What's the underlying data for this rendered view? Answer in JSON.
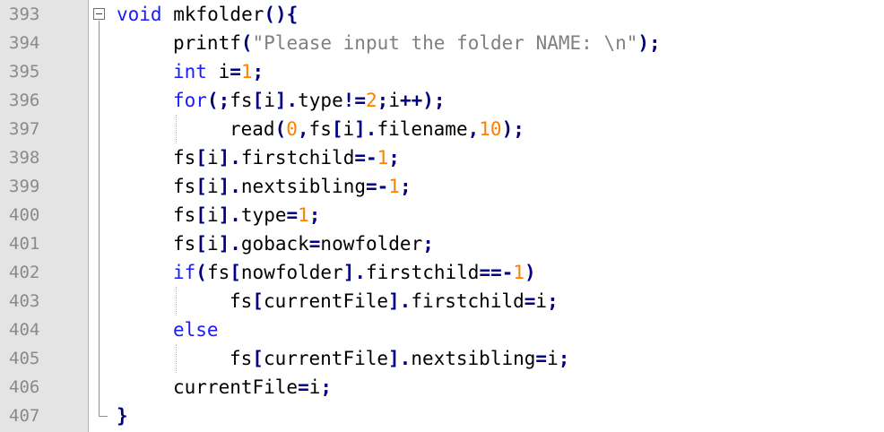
{
  "editor": {
    "lines": [
      {
        "number": "393",
        "tokens": [
          {
            "t": "void",
            "c": "kw"
          },
          {
            "t": " mkfolder",
            "c": "id"
          },
          {
            "t": "(){",
            "c": "op"
          }
        ],
        "indent": 0
      },
      {
        "number": "394",
        "tokens": [
          {
            "t": "printf",
            "c": "id"
          },
          {
            "t": "(",
            "c": "op"
          },
          {
            "t": "\"Please input the folder NAME: \\n\"",
            "c": "str"
          },
          {
            "t": ");",
            "c": "op"
          }
        ],
        "indent": 1
      },
      {
        "number": "395",
        "tokens": [
          {
            "t": "int",
            "c": "kw"
          },
          {
            "t": " i",
            "c": "id"
          },
          {
            "t": "=",
            "c": "op"
          },
          {
            "t": "1",
            "c": "num"
          },
          {
            "t": ";",
            "c": "op"
          }
        ],
        "indent": 1
      },
      {
        "number": "396",
        "tokens": [
          {
            "t": "for",
            "c": "kw"
          },
          {
            "t": "(;",
            "c": "op"
          },
          {
            "t": "fs",
            "c": "id"
          },
          {
            "t": "[",
            "c": "op"
          },
          {
            "t": "i",
            "c": "id"
          },
          {
            "t": "].",
            "c": "op"
          },
          {
            "t": "type",
            "c": "id"
          },
          {
            "t": "!=",
            "c": "op"
          },
          {
            "t": "2",
            "c": "num"
          },
          {
            "t": ";",
            "c": "op"
          },
          {
            "t": "i",
            "c": "id"
          },
          {
            "t": "++);",
            "c": "op"
          }
        ],
        "indent": 1
      },
      {
        "number": "397",
        "tokens": [
          {
            "t": "read",
            "c": "id"
          },
          {
            "t": "(",
            "c": "op"
          },
          {
            "t": "0",
            "c": "num"
          },
          {
            "t": ",",
            "c": "op"
          },
          {
            "t": "fs",
            "c": "id"
          },
          {
            "t": "[",
            "c": "op"
          },
          {
            "t": "i",
            "c": "id"
          },
          {
            "t": "].",
            "c": "op"
          },
          {
            "t": "filename",
            "c": "id"
          },
          {
            "t": ",",
            "c": "op"
          },
          {
            "t": "10",
            "c": "num"
          },
          {
            "t": ");",
            "c": "op"
          }
        ],
        "indent": 2
      },
      {
        "number": "398",
        "tokens": [
          {
            "t": "fs",
            "c": "id"
          },
          {
            "t": "[",
            "c": "op"
          },
          {
            "t": "i",
            "c": "id"
          },
          {
            "t": "].",
            "c": "op"
          },
          {
            "t": "firstchild",
            "c": "id"
          },
          {
            "t": "=-",
            "c": "op"
          },
          {
            "t": "1",
            "c": "num"
          },
          {
            "t": ";",
            "c": "op"
          }
        ],
        "indent": 1
      },
      {
        "number": "399",
        "tokens": [
          {
            "t": "fs",
            "c": "id"
          },
          {
            "t": "[",
            "c": "op"
          },
          {
            "t": "i",
            "c": "id"
          },
          {
            "t": "].",
            "c": "op"
          },
          {
            "t": "nextsibling",
            "c": "id"
          },
          {
            "t": "=-",
            "c": "op"
          },
          {
            "t": "1",
            "c": "num"
          },
          {
            "t": ";",
            "c": "op"
          }
        ],
        "indent": 1
      },
      {
        "number": "400",
        "tokens": [
          {
            "t": "fs",
            "c": "id"
          },
          {
            "t": "[",
            "c": "op"
          },
          {
            "t": "i",
            "c": "id"
          },
          {
            "t": "].",
            "c": "op"
          },
          {
            "t": "type",
            "c": "id"
          },
          {
            "t": "=",
            "c": "op"
          },
          {
            "t": "1",
            "c": "num"
          },
          {
            "t": ";",
            "c": "op"
          }
        ],
        "indent": 1
      },
      {
        "number": "401",
        "tokens": [
          {
            "t": "fs",
            "c": "id"
          },
          {
            "t": "[",
            "c": "op"
          },
          {
            "t": "i",
            "c": "id"
          },
          {
            "t": "].",
            "c": "op"
          },
          {
            "t": "goback",
            "c": "id"
          },
          {
            "t": "=",
            "c": "op"
          },
          {
            "t": "nowfolder",
            "c": "id"
          },
          {
            "t": ";",
            "c": "op"
          }
        ],
        "indent": 1
      },
      {
        "number": "402",
        "tokens": [
          {
            "t": "if",
            "c": "kw"
          },
          {
            "t": "(",
            "c": "op"
          },
          {
            "t": "fs",
            "c": "id"
          },
          {
            "t": "[",
            "c": "op"
          },
          {
            "t": "nowfolder",
            "c": "id"
          },
          {
            "t": "].",
            "c": "op"
          },
          {
            "t": "firstchild",
            "c": "id"
          },
          {
            "t": "==-",
            "c": "op"
          },
          {
            "t": "1",
            "c": "num"
          },
          {
            "t": ")",
            "c": "op"
          }
        ],
        "indent": 1
      },
      {
        "number": "403",
        "tokens": [
          {
            "t": "fs",
            "c": "id"
          },
          {
            "t": "[",
            "c": "op"
          },
          {
            "t": "currentFile",
            "c": "id"
          },
          {
            "t": "].",
            "c": "op"
          },
          {
            "t": "firstchild",
            "c": "id"
          },
          {
            "t": "=",
            "c": "op"
          },
          {
            "t": "i",
            "c": "id"
          },
          {
            "t": ";",
            "c": "op"
          }
        ],
        "indent": 2
      },
      {
        "number": "404",
        "tokens": [
          {
            "t": "else",
            "c": "kw"
          }
        ],
        "indent": 1
      },
      {
        "number": "405",
        "tokens": [
          {
            "t": "fs",
            "c": "id"
          },
          {
            "t": "[",
            "c": "op"
          },
          {
            "t": "currentFile",
            "c": "id"
          },
          {
            "t": "].",
            "c": "op"
          },
          {
            "t": "nextsibling",
            "c": "id"
          },
          {
            "t": "=",
            "c": "op"
          },
          {
            "t": "i",
            "c": "id"
          },
          {
            "t": ";",
            "c": "op"
          }
        ],
        "indent": 2
      },
      {
        "number": "406",
        "tokens": [
          {
            "t": "currentFile",
            "c": "id"
          },
          {
            "t": "=",
            "c": "op"
          },
          {
            "t": "i",
            "c": "id"
          },
          {
            "t": ";",
            "c": "op"
          }
        ],
        "indent": 1
      },
      {
        "number": "407",
        "tokens": [
          {
            "t": "}",
            "c": "op"
          }
        ],
        "indent": 0
      }
    ]
  },
  "colors": {
    "keyword": "#1a1aff",
    "number": "#ff8000",
    "string": "#808080",
    "operator": "#000080",
    "identifier": "#000000",
    "line_number": "#8a8a8a",
    "gutter_bg": "#e4e4e4"
  }
}
